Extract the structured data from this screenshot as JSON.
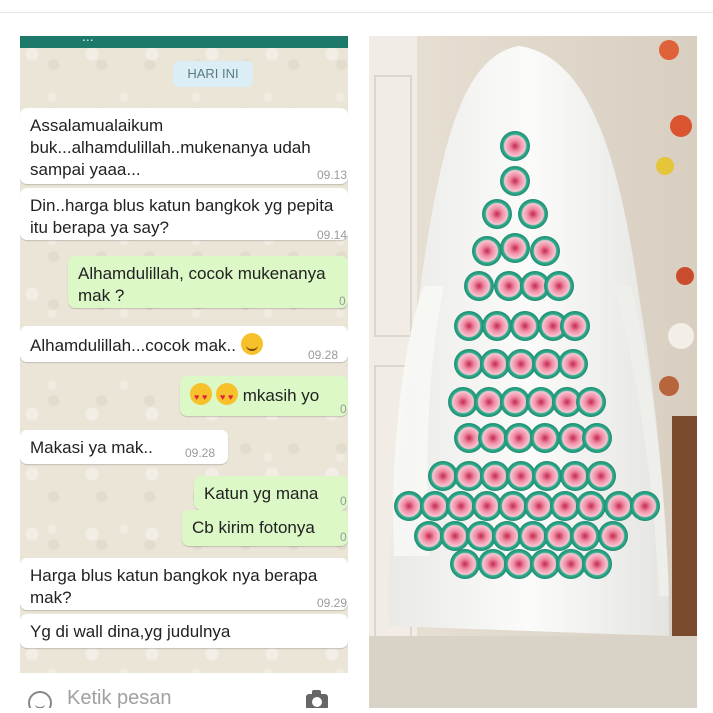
{
  "chat": {
    "header_title": "...",
    "date_chip": "HARI INI",
    "messages": [
      {
        "dir": "in",
        "text": "Assalamualaikum buk...alhamdulillah..mukenanya udah sampai yaaa...",
        "time": "09.13"
      },
      {
        "dir": "in",
        "text": "Din..harga blus katun bangkok yg pepita itu berapa ya say?",
        "time": "09.14"
      },
      {
        "dir": "out",
        "text": "Alhamdulillah, cocok mukenanya mak ?",
        "time": "0"
      },
      {
        "dir": "in",
        "text": "Alhamdulillah...cocok mak..",
        "emoji": "smile-emoji",
        "time": "09.28"
      },
      {
        "dir": "out",
        "text": "mkasih yo",
        "emoji": "heart-eyes-emoji",
        "time": "0"
      },
      {
        "dir": "in",
        "text": "Makasi ya mak..",
        "time": "09.28"
      },
      {
        "dir": "out",
        "text": "Katun yg mana",
        "time": "0"
      },
      {
        "dir": "out",
        "text": "Cb kirim fotonya",
        "time": "0"
      },
      {
        "dir": "in",
        "text": "Harga blus katun bangkok nya berapa mak?",
        "time": "09.29"
      },
      {
        "dir": "in",
        "text": "Yg di wall dina,yg judulnya",
        "time": ""
      }
    ],
    "input_placeholder": "Ketik pesan"
  },
  "photo": {
    "subject": "white mukena with green and pink crochet flower panel",
    "colors": {
      "fabric": "#f4f4f2",
      "crochet_green": "#2fae8e",
      "crochet_pink": "#e66b8a",
      "wall": "#e9e2d6"
    }
  },
  "colors": {
    "chat_bg": "#ebe5d8",
    "incoming": "#ffffff",
    "outgoing": "#dcf8c6",
    "header": "#1d7a6b"
  }
}
